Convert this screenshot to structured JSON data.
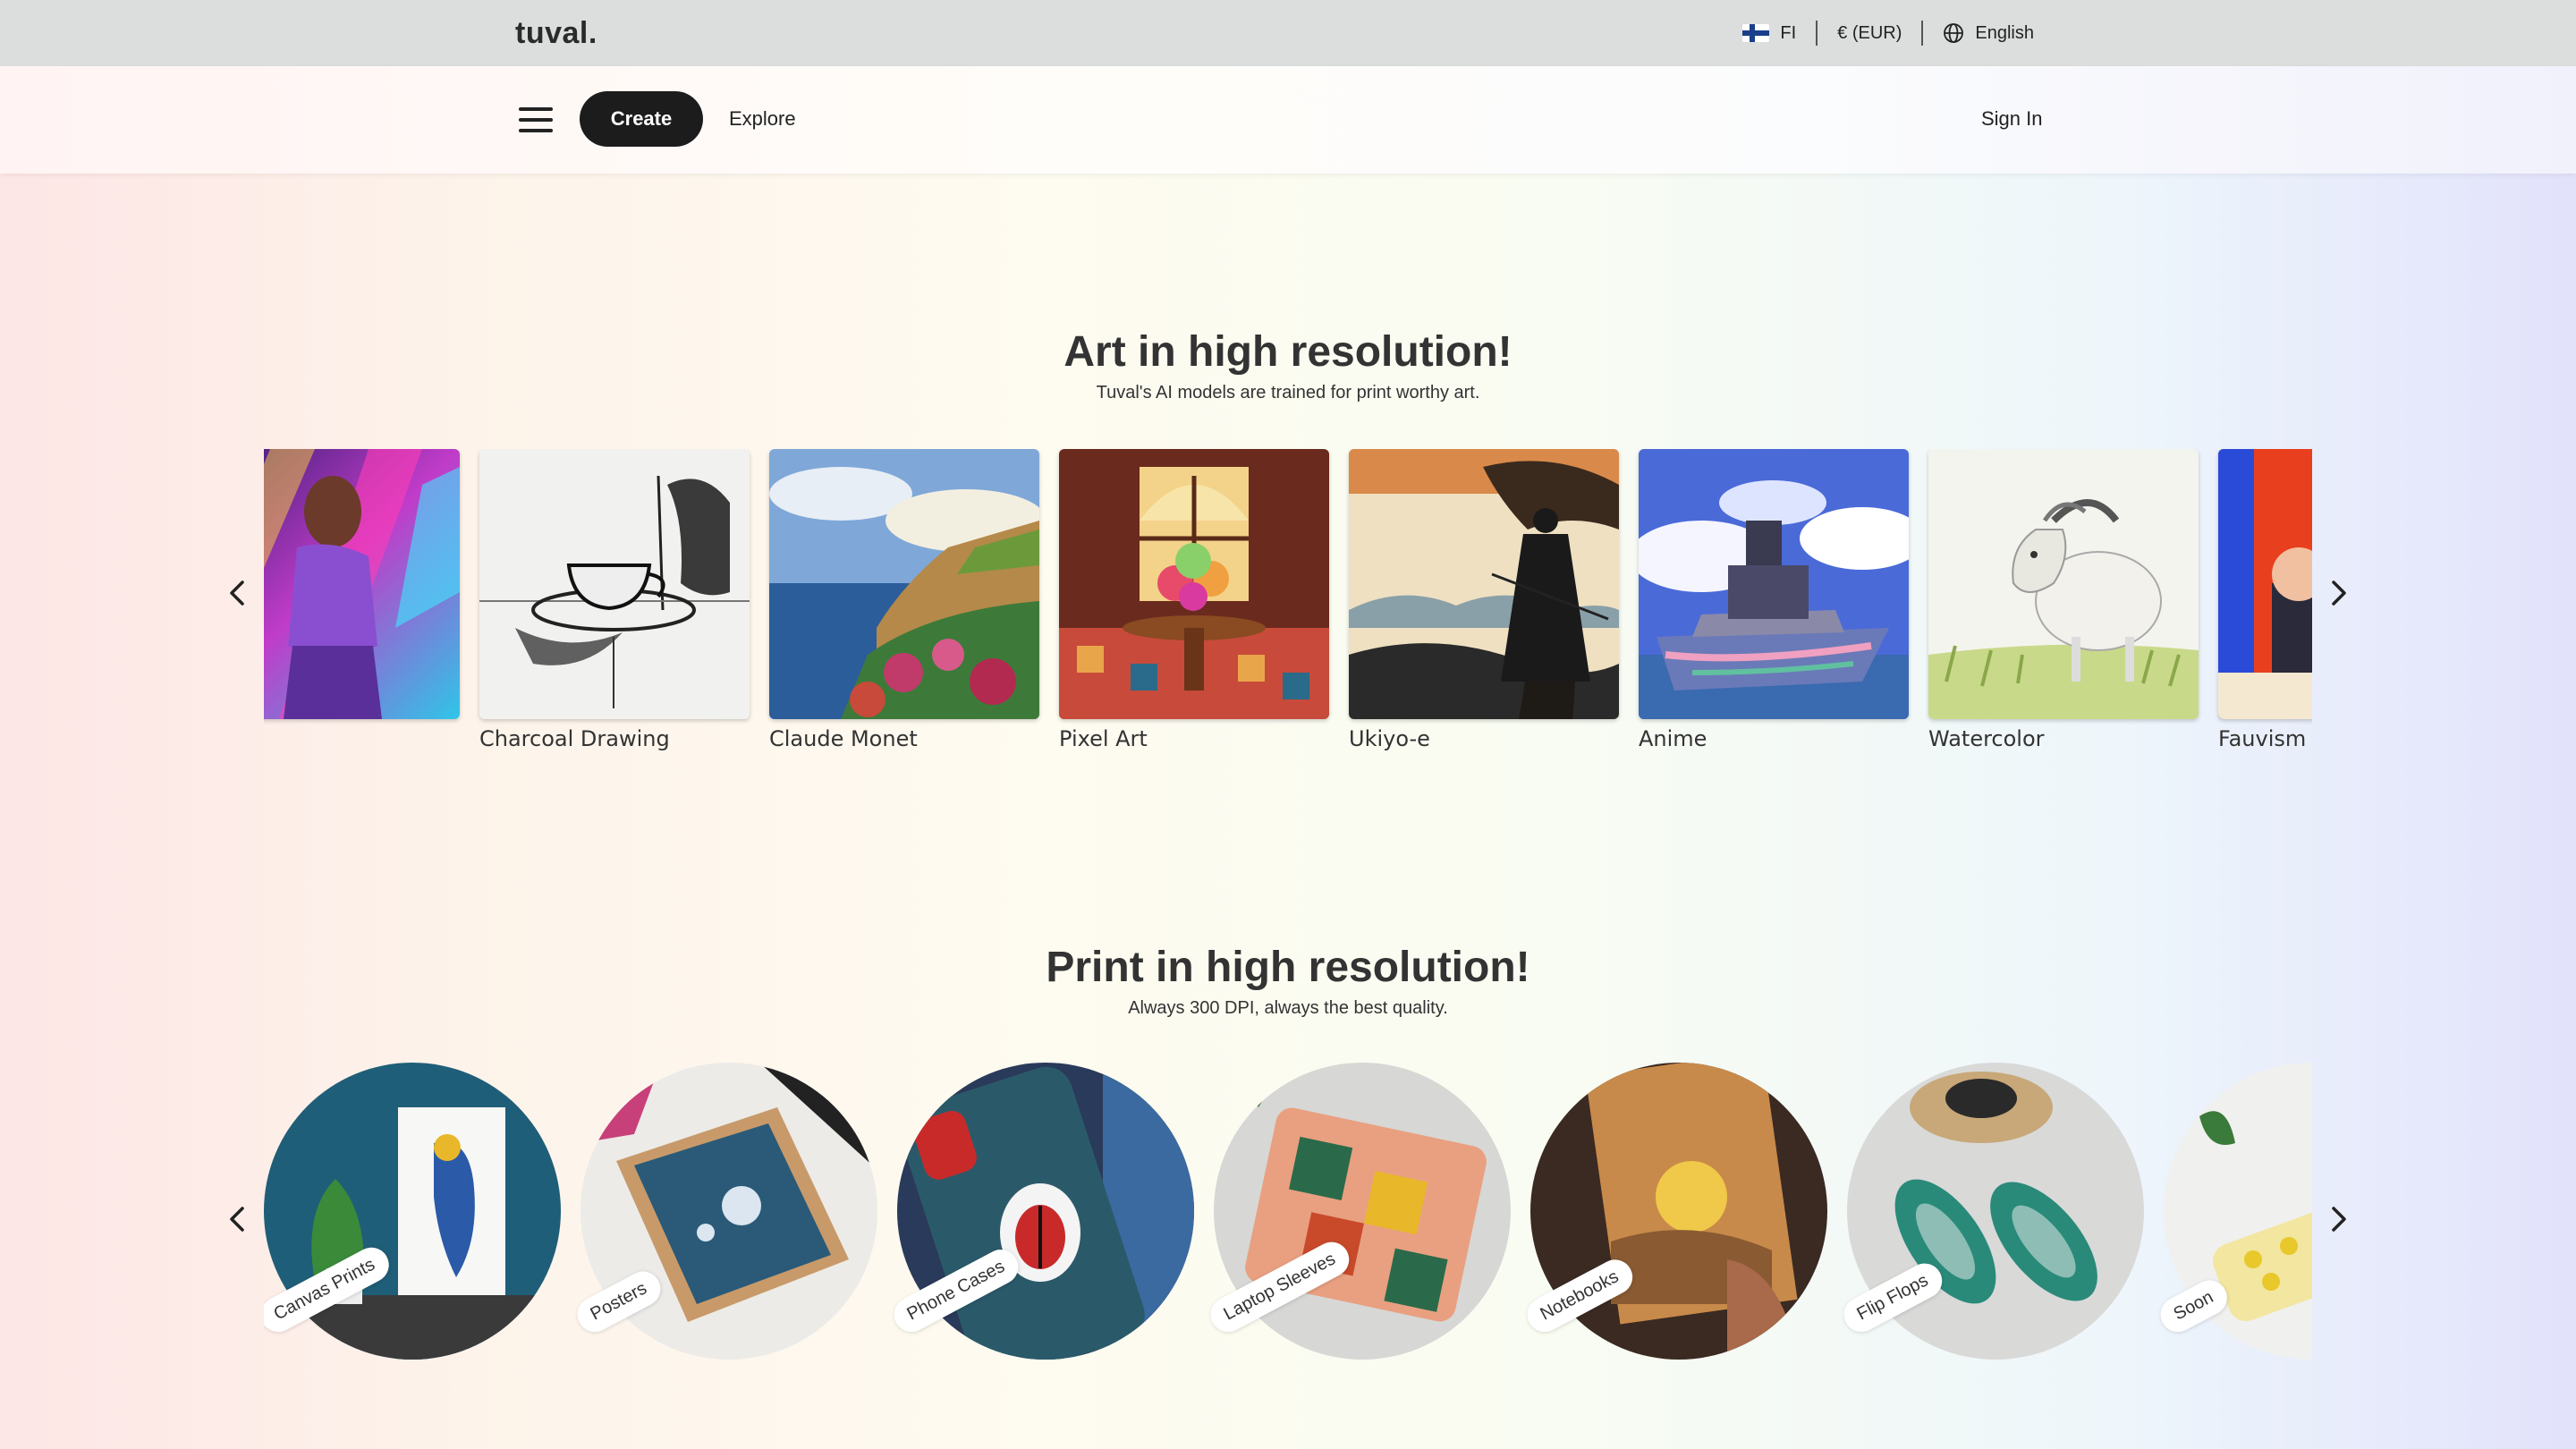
{
  "topbar": {
    "logo": "tuval.",
    "country": "FI",
    "currency": "€ (EUR)",
    "language": "English"
  },
  "navbar": {
    "create_label": "Create",
    "explore_label": "Explore",
    "signin_label": "Sign In"
  },
  "art_section": {
    "title": "Art in high resolution!",
    "subtitle": "Tuval's AI models are trained for print worthy art.",
    "styles": [
      {
        "label": ""
      },
      {
        "label": "Charcoal Drawing"
      },
      {
        "label": "Claude Monet"
      },
      {
        "label": "Pixel Art"
      },
      {
        "label": "Ukiyo-e"
      },
      {
        "label": "Anime"
      },
      {
        "label": "Watercolor"
      },
      {
        "label": "Fauvism"
      }
    ]
  },
  "print_section": {
    "title": "Print in high resolution!",
    "subtitle": "Always 300 DPI, always the best quality.",
    "products": [
      {
        "label": "Canvas Prints"
      },
      {
        "label": "Posters"
      },
      {
        "label": "Phone Cases"
      },
      {
        "label": "Laptop Sleeves"
      },
      {
        "label": "Notebooks"
      },
      {
        "label": "Flip Flops"
      },
      {
        "label": "Soon"
      }
    ]
  },
  "colors": {
    "topbar_bg": "#dcdedd",
    "button_dark": "#1c1c1c",
    "text_dark": "#333333"
  },
  "icons": {
    "menu": "hamburger-icon",
    "prev": "chevron-left-icon",
    "next": "chevron-right-icon",
    "language": "globe-icon",
    "country": "finland-flag-icon"
  }
}
